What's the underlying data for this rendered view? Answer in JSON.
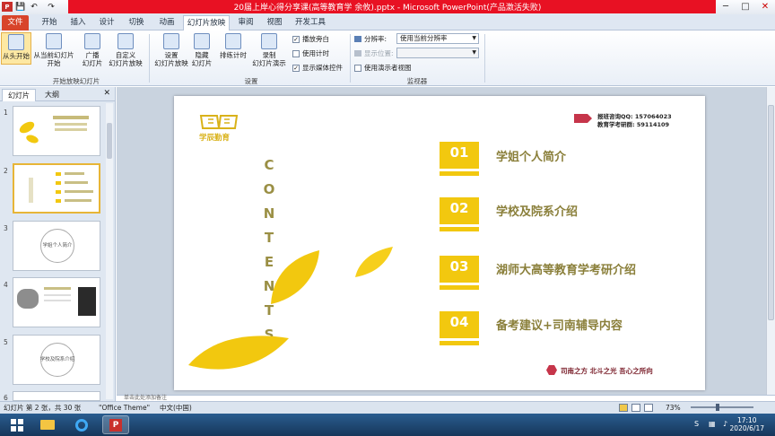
{
  "titlebar": {
    "title": "20届上岸心得分享课(高等教育学 余攸).pptx - Microsoft PowerPoint(产品激活失败)",
    "quick_access": {
      "save": "💾",
      "undo": "↶",
      "redo": "↷"
    },
    "controls": {
      "minimize": "─",
      "maximize": "□",
      "close": "✕"
    }
  },
  "menu": {
    "file": "文件",
    "tabs": [
      "开始",
      "插入",
      "设计",
      "切换",
      "动画",
      "幻灯片放映",
      "审阅",
      "视图",
      "开发工具"
    ],
    "active_tab": "幻灯片放映"
  },
  "ribbon": {
    "start_group": {
      "from_beginning": "从头开始",
      "from_current_1": "从当前幻灯片",
      "from_current_2": "开始",
      "broadcast_1": "广播",
      "broadcast_2": "幻灯片",
      "custom_1": "自定义",
      "custom_2": "幻灯片放映",
      "label": "开始放映幻灯片"
    },
    "setup_group": {
      "setup_1": "设置",
      "setup_2": "幻灯片放映",
      "hide_1": "隐藏",
      "hide_2": "幻灯片",
      "rehearse": "排练计时",
      "record_1": "录制",
      "record_2": "幻灯片演示",
      "play_narration": "播放旁白",
      "use_timings": "使用计时",
      "show_media": "显示媒体控件",
      "label": "设置"
    },
    "monitors_group": {
      "resolution_label": "分辨率:",
      "resolution_value": "使用当前分辨率",
      "show_on_label": "显示位置:",
      "presenter_view": "使用演示者视图",
      "label": "监视器"
    }
  },
  "panel": {
    "tab_slides": "幻灯片",
    "tab_outline": "大纲",
    "close": "✕",
    "thumbs": [
      {
        "num": "1",
        "text": ""
      },
      {
        "num": "2",
        "text": ""
      },
      {
        "num": "3",
        "text": "学姐个人简介"
      },
      {
        "num": "4",
        "text": ""
      },
      {
        "num": "5",
        "text": "学校及院系介绍"
      },
      {
        "num": "6",
        "text": ""
      }
    ]
  },
  "slide": {
    "logo_text": "学辰勤育",
    "contents_letters": [
      "C",
      "O",
      "N",
      "T",
      "E",
      "N",
      "T",
      "S"
    ],
    "contact_line1": "报班咨询QQ: 157064023",
    "contact_line2": "教育学考研群: 59114109",
    "items": [
      {
        "num": "01",
        "title": "学姐个人简介"
      },
      {
        "num": "02",
        "title": "学校及院系介绍"
      },
      {
        "num": "03",
        "title": "湖师大高等教育学考研介绍"
      },
      {
        "num": "04",
        "title": "备考建议+司南辅导内容"
      }
    ],
    "footer": "司南之方 北斗之光 吾心之所向"
  },
  "notes_placeholder": "单击此处添加备注",
  "status": {
    "slide_info": "幻灯片 第 2 张，共 30 张",
    "theme": "\"Office Theme\"",
    "language": "中文(中国)",
    "zoom": "73%"
  },
  "taskbar": {
    "time": "17:10",
    "date": "2020/6/17",
    "ime": "S"
  },
  "colors": {
    "accent_yellow": "#f2c80f",
    "title_olive": "#8a7f3a",
    "file_tab": "#d8442a",
    "title_red": "#e81123"
  }
}
